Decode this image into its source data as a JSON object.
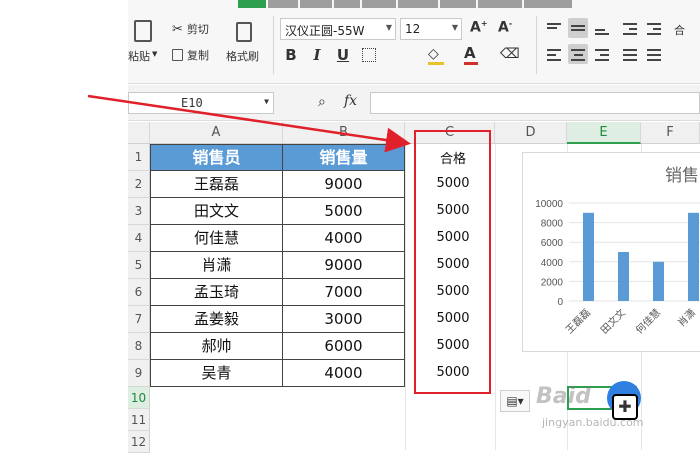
{
  "ribbon": {
    "paste_label": "粘贴",
    "cut_label": "剪切",
    "copy_label": "复制",
    "format_painter_label": "格式刷",
    "font_name": "汉仪正圆-55W",
    "font_size": "12",
    "merge_label": "合"
  },
  "formula_bar": {
    "name_box": "E10",
    "fx_label": "fx",
    "formula_value": ""
  },
  "columns": [
    "A",
    "B",
    "C",
    "D",
    "E",
    "F"
  ],
  "rows": [
    "1",
    "2",
    "3",
    "4",
    "5",
    "6",
    "7",
    "8",
    "9",
    "10",
    "11",
    "12"
  ],
  "table": {
    "headers": [
      "销售员",
      "销售量"
    ],
    "rows": [
      [
        "王磊磊",
        "9000"
      ],
      [
        "田文文",
        "5000"
      ],
      [
        "何佳慧",
        "4000"
      ],
      [
        "肖潇",
        "9000"
      ],
      [
        "孟玉琦",
        "7000"
      ],
      [
        "孟姜毅",
        "3000"
      ],
      [
        "郝帅",
        "6000"
      ],
      [
        "吴青",
        "4000"
      ]
    ]
  },
  "column_c": {
    "header": "合格",
    "values": [
      "5000",
      "5000",
      "5000",
      "5000",
      "5000",
      "5000",
      "5000",
      "5000"
    ]
  },
  "chart_data": {
    "type": "bar",
    "title": "销售",
    "categories": [
      "王磊磊",
      "田文文",
      "何佳慧",
      "肖潇"
    ],
    "values": [
      9000,
      5000,
      4000,
      9000
    ],
    "yticks": [
      "10000",
      "8000",
      "6000",
      "4000",
      "2000",
      "0"
    ],
    "ylim": [
      0,
      10000
    ],
    "color": "#5b9bd5"
  },
  "watermark": {
    "main": "Baid",
    "sub": "jingyan.baidu.com"
  },
  "colors": {
    "accent_green": "#2e9e4f",
    "header_blue": "#5b9bd5",
    "annotation_red": "#e0202a"
  }
}
